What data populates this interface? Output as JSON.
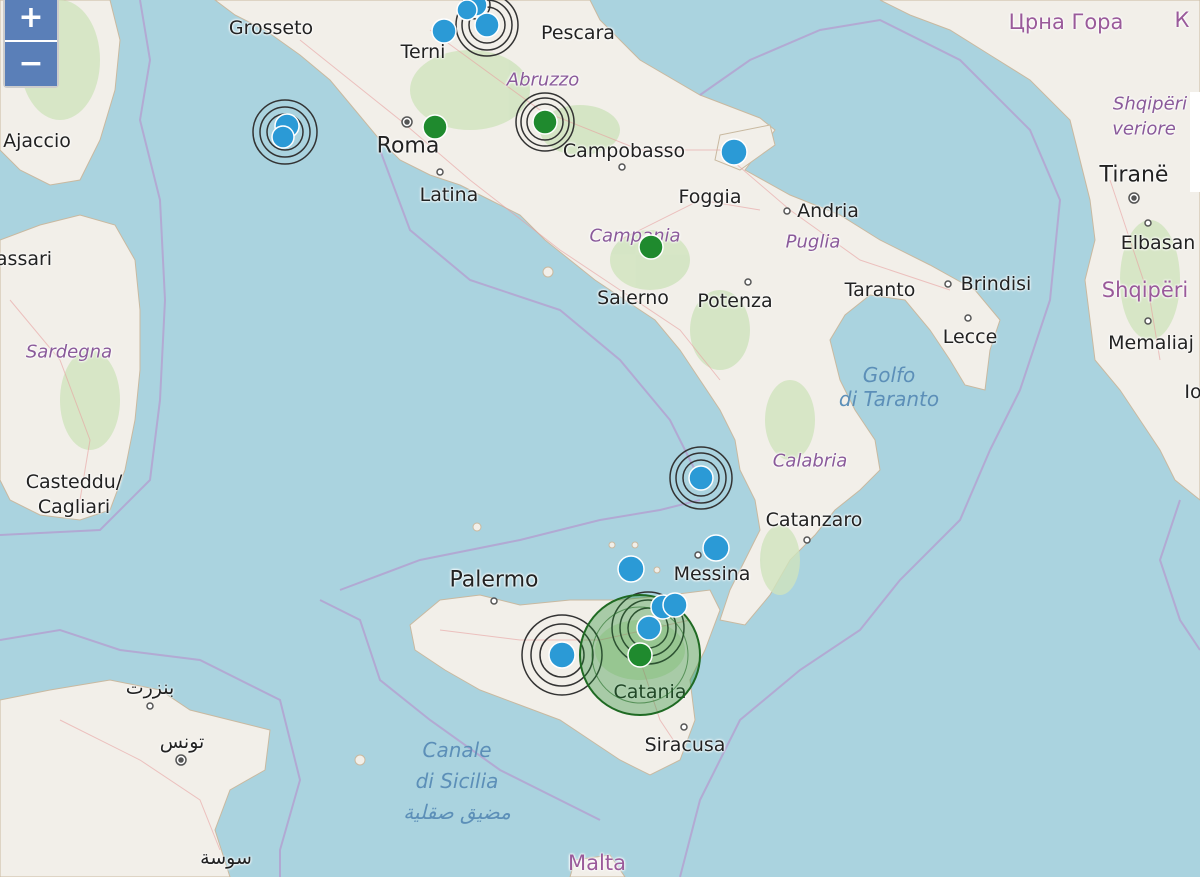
{
  "map": {
    "zoom_in_label": "+",
    "zoom_out_label": "−",
    "labels": {
      "grosseto": "Grosseto",
      "terni": "Terni",
      "pescara": "Pescara",
      "abruzzo": "Abruzzo",
      "ajaccio": "Ajaccio",
      "roma": "Roma",
      "campobasso": "Campobasso",
      "latina": "Latina",
      "foggia": "Foggia",
      "andria": "Andria",
      "sassari": "assari",
      "campania": "Campania",
      "puglia": "Puglia",
      "salerno": "Salerno",
      "potenza": "Potenza",
      "taranto": "Taranto",
      "brindisi": "Brindisi",
      "lecce": "Lecce",
      "sardegna": "Sardegna",
      "golfo1": "Golfo",
      "golfo2": "di Taranto",
      "calabria": "Calabria",
      "casteddu": "Casteddu/",
      "cagliari": "Cagliari",
      "catanzaro": "Catanzaro",
      "palermo": "Palermo",
      "messina": "Messina",
      "catania": "Catania",
      "siracusa": "Siracusa",
      "canale1": "Canale",
      "canale2": "di Sicilia",
      "canale3": "مضيق صقلية",
      "bizerte": "بنزرت",
      "tunis": "تونس",
      "sousse": "سوسة",
      "malta": "Malta",
      "crna_gora": "Црна Гора",
      "k_label": "К",
      "shqiperi_veriore1": "Shqipëri",
      "shqiperi_veriore2": "veriore",
      "tirane": "Tiranë",
      "elbasan": "Elbasan",
      "shqiperi": "Shqipëri",
      "memaliaj": "Memaliaj",
      "io": "Io"
    },
    "colors": {
      "sea": "#aad3df",
      "land": "#f2efe9",
      "green_area": "#cfe3bd",
      "marker_blue": "#2b9ad6",
      "marker_green": "#1f8a2e"
    },
    "markers": [
      {
        "type": "blue",
        "label": "quake-terni"
      },
      {
        "type": "blue",
        "label": "quake-abruzzo-north"
      },
      {
        "type": "green",
        "label": "quake-roma-east"
      },
      {
        "type": "green",
        "label": "quake-abruzzo"
      },
      {
        "type": "blue",
        "label": "quake-tyrrhenian"
      },
      {
        "type": "blue",
        "label": "quake-gargano"
      },
      {
        "type": "green",
        "label": "quake-campania"
      },
      {
        "type": "blue",
        "label": "quake-aeolian"
      },
      {
        "type": "blue",
        "label": "quake-messina-north"
      },
      {
        "type": "blue",
        "label": "quake-tyrrhenian-sicily"
      },
      {
        "type": "blue",
        "label": "quake-nebrodi"
      },
      {
        "type": "blue",
        "label": "quake-etna"
      },
      {
        "type": "green",
        "label": "quake-catania-major"
      },
      {
        "type": "blue",
        "label": "quake-central-sicily"
      }
    ]
  }
}
